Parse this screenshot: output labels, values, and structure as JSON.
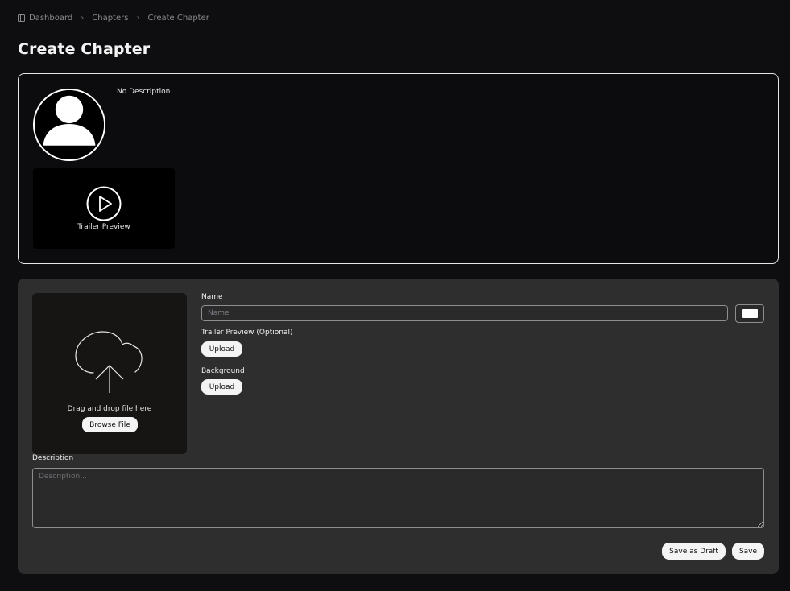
{
  "breadcrumb": {
    "items": [
      {
        "label": "Dashboard",
        "icon": "dashboard-icon"
      },
      {
        "label": "Chapters"
      },
      {
        "label": "Create Chapter"
      }
    ],
    "separator": "›"
  },
  "page": {
    "title": "Create Chapter"
  },
  "preview": {
    "description": "No Description",
    "avatar_icon": "user-silhouette-icon",
    "trailer_icon": "play-icon",
    "trailer_label": "Trailer Preview"
  },
  "form": {
    "upload_zone": {
      "icon": "cloud-upload-icon",
      "text": "Drag and drop file here",
      "browse_label": "Browse File"
    },
    "name": {
      "label": "Name",
      "placeholder": "Name",
      "value": ""
    },
    "color_swatch": {
      "value": "#ffffff"
    },
    "trailer": {
      "label": "Trailer Preview (Optional)",
      "button_label": "Upload"
    },
    "background": {
      "label": "Background",
      "button_label": "Upload"
    },
    "description": {
      "label": "Description",
      "placeholder": "Description...",
      "value": ""
    },
    "actions": {
      "save_draft_label": "Save as Draft",
      "save_label": "Save"
    }
  },
  "colors": {
    "page_bg": "#0e0e10",
    "card_bg": "#2e2e2f",
    "dropzone_bg": "#161513",
    "button_bg": "#f4f4f4",
    "button_text": "#111111",
    "border": "#8e8e92"
  }
}
